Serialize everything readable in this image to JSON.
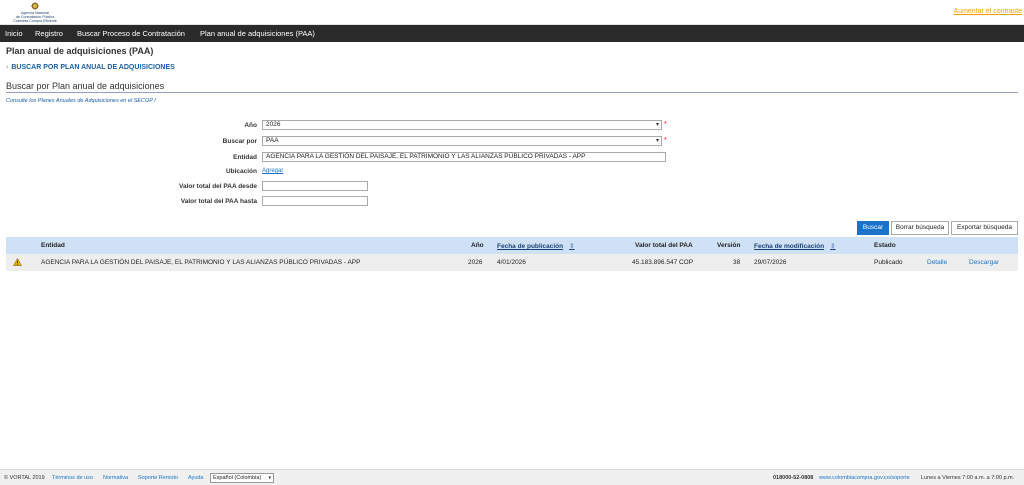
{
  "header": {
    "logo_lines": [
      "Agencia Nacional",
      "de Contratación Pública",
      "Colombia Compra Eficiente"
    ],
    "top_link": "Aumentar el contraste"
  },
  "nav": [
    "Inicio",
    "Registro",
    "Buscar Proceso de Contratación",
    "Plan anual de adquisiciones (PAA)"
  ],
  "page": {
    "title": "Plan anual de adquisiciones (PAA)",
    "section_link": "BUSCAR POR PLAN ANUAL DE ADQUISICIONES",
    "section_heading": "Buscar por Plan anual de adquisiciones",
    "secop_note": "Consulte los Planes Anuales de Adquisiciones en el SECOP I"
  },
  "form": {
    "year_label": "Año",
    "year_value": "2026",
    "search_by_label": "Buscar por",
    "search_by_value": "PAA",
    "entity_label": "Entidad",
    "entity_value": "AGENCIA PARA LA GESTIÓN DEL PAISAJE, EL PATRIMONIO Y LAS ALIANZAS PÚBLICO PRIVADAS - APP",
    "location_label": "Ubicación",
    "location_add": "Agregar",
    "total_from_label": "Valor total del PAA desde",
    "total_from_value": "",
    "total_to_label": "Valor total del PAA hasta",
    "total_to_value": "",
    "required_mark": "*"
  },
  "buttons": {
    "search": "Buscar",
    "clear": "Borrar búsqueda",
    "export": "Exportar búsqueda"
  },
  "table": {
    "headers": {
      "entity": "Entidad",
      "year": "Año",
      "pub_date": "Fecha de publicación",
      "total": "Valor total del PAA",
      "version": "Versión",
      "mod_date": "Fecha de modificación",
      "status": "Estado"
    },
    "sort_icon": "⇕",
    "rows": [
      {
        "entity": "AGENCIA PARA LA GESTIÓN DEL PAISAJE, EL PATRIMONIO Y LAS ALIANZAS PÚBLICO PRIVADAS - APP",
        "year": "2026",
        "pub_date": "4/01/2026",
        "total": "45.183.896.547 COP",
        "version": "38",
        "mod_date": "29/07/2026",
        "status": "Publicado",
        "detail": "Detalle",
        "download": "Descargar"
      }
    ]
  },
  "footer": {
    "copyright": "© VORTAL 2019",
    "links": [
      "Términos de uso",
      "Normativa",
      "Soporte Remoto",
      "Ayuda"
    ],
    "language": "Español (Colombia)",
    "phone": "018000-52-0808",
    "support_url": "www.colombiacompra.gov.co/soporte",
    "hours": "Lunes a Viernes 7:00 a.m. a 7:00 p.m."
  },
  "colors": {
    "accent": "#1a73c9",
    "navbar": "#2a2a2a",
    "table_header": "#cfe2f5",
    "warning": "#e8b400"
  }
}
